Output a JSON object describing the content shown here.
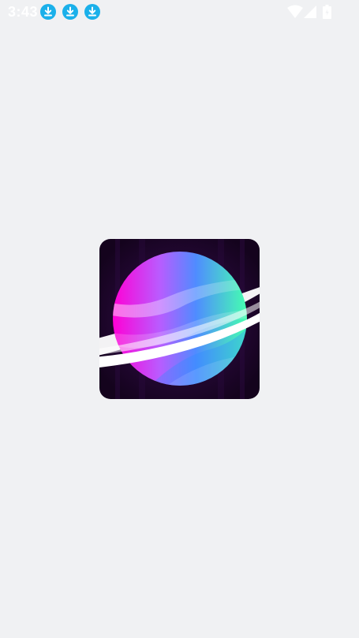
{
  "status_bar": {
    "time": "3:43",
    "notifications": [
      "download-icon",
      "download-icon",
      "download-icon"
    ],
    "right_icons": [
      "wifi-icon",
      "cell-signal-icon",
      "battery-icon"
    ],
    "icon_color": "#1ab0ea"
  },
  "splash": {
    "logo_icon": "planet-logo-icon",
    "background_color": "#f0f1f3",
    "logo_background": "#1a0525"
  }
}
